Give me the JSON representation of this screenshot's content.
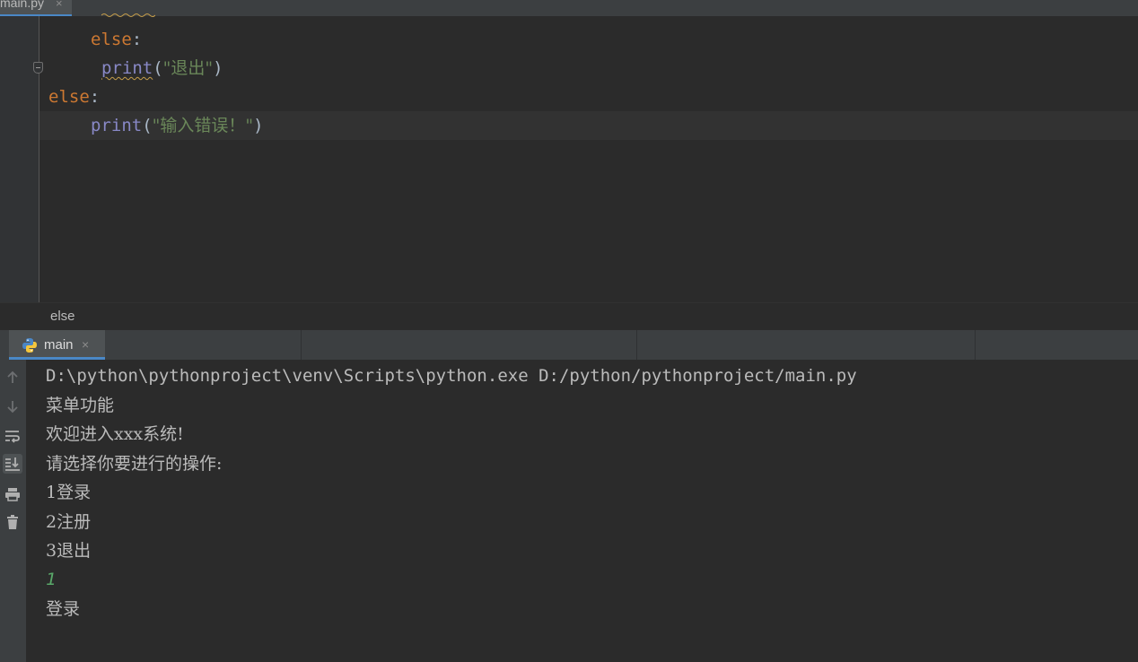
{
  "editor": {
    "file_tab": {
      "name": "main.py",
      "close": "×"
    },
    "lines": [
      {
        "keyword": "else",
        "colon": ":"
      },
      {
        "func": "print",
        "open": "(",
        "string": "\"退出\"",
        "close": ")"
      },
      {
        "keyword": "else",
        "colon": ":"
      },
      {
        "func": "print",
        "open": "(",
        "string": "\"输入错误！\"",
        "close": ")"
      }
    ]
  },
  "breadcrumb": {
    "item": "else"
  },
  "run_panel": {
    "tab": {
      "label": "main",
      "close": "×"
    },
    "output": [
      "D:\\python\\pythonproject\\venv\\Scripts\\python.exe D:/python/pythonproject/main.py",
      "菜单功能",
      "欢迎进入xxx系统!",
      "请选择你要进行的操作:",
      "1登录",
      "2注册",
      "3退出",
      "1",
      "登录"
    ]
  },
  "colors": {
    "keyword": "#cc7832",
    "function": "#8888c6",
    "string": "#6a8759",
    "user_input": "#59a869",
    "accent": "#4a88c7"
  }
}
